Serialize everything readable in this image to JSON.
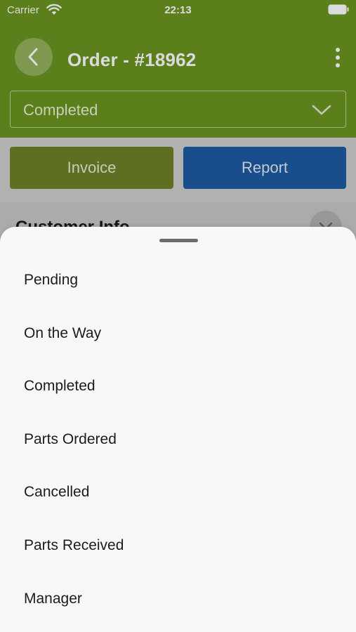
{
  "status_bar": {
    "carrier": "Carrier",
    "time": "22:13"
  },
  "header": {
    "title": "Order - #18962",
    "selected_status": "Completed"
  },
  "actions": {
    "invoice_label": "Invoice",
    "report_label": "Report"
  },
  "section": {
    "title": "Customer Info"
  },
  "sheet": {
    "options": [
      "Pending",
      "On the Way",
      "Completed",
      "Parts Ordered",
      "Cancelled",
      "Parts Received",
      "Manager"
    ]
  },
  "colors": {
    "header_green": "#6a9520",
    "invoice_button": "#6f8227",
    "report_button": "#1d5ba4",
    "sheet_background": "#f8f8f8"
  }
}
